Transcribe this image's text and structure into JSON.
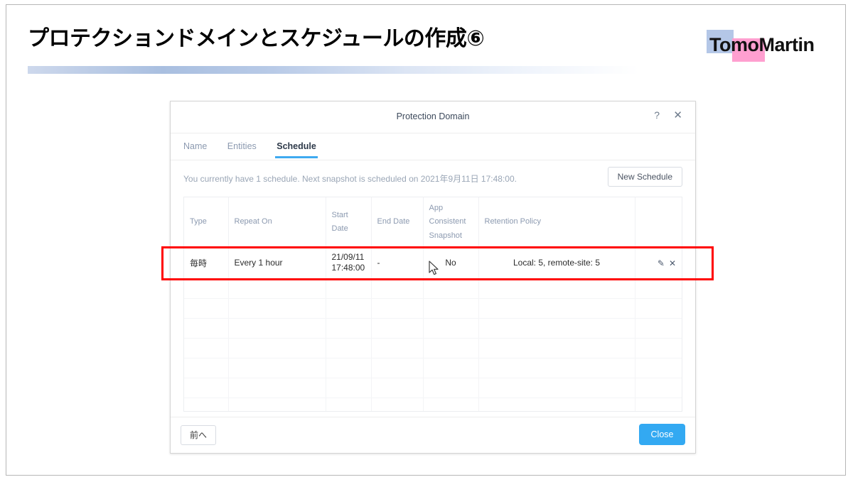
{
  "slide": {
    "title": "プロテクションドメインとスケジュールの作成⑥",
    "logo": {
      "text": "TomoMartin",
      "accent_blue": "#b4c7e7",
      "accent_pink": "#ff9fd0"
    },
    "highlight_color": "#ff0000"
  },
  "dialog": {
    "title": "Protection Domain",
    "help_icon": "?",
    "close_icon": "✕",
    "tabs": [
      {
        "label": "Name",
        "active": false
      },
      {
        "label": "Entities",
        "active": false
      },
      {
        "label": "Schedule",
        "active": true
      }
    ],
    "info_text": "You currently have 1 schedule. Next snapshot is scheduled on 2021年9月11日 17:48:00.",
    "new_schedule_label": "New Schedule",
    "table": {
      "columns": [
        "Type",
        "Repeat On",
        "Start Date",
        "End Date",
        "App Consistent Snapshot",
        "Retention Policy",
        ""
      ],
      "rows": [
        {
          "type": "毎時",
          "repeat_on": "Every 1 hour",
          "start_date_line1": "21/09/11",
          "start_date_line2": "17:48:00",
          "end_date": "-",
          "app_consistent_snapshot": "No",
          "retention_policy": "Local: 5, remote-site: 5",
          "edit_icon": "✎",
          "delete_icon": "✕"
        }
      ],
      "empty_row_count": 9
    },
    "footer": {
      "prev_label": "前へ",
      "close_label": "Close",
      "close_color": "#33a9f2"
    }
  }
}
